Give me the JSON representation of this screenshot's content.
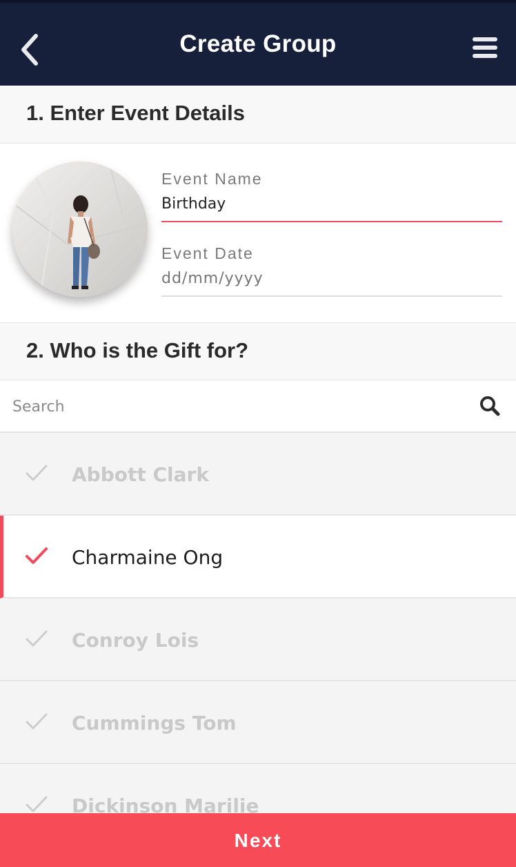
{
  "header": {
    "title": "Create Group",
    "back_icon": "chevron-left-icon",
    "menu_icon": "hamburger-menu-icon"
  },
  "section1": {
    "heading": "1. Enter Event Details",
    "avatar_icon": "event-photo",
    "event_name": {
      "label": "Event Name",
      "value": "Birthday"
    },
    "event_date": {
      "label": "Event Date",
      "placeholder": "dd/mm/yyyy"
    }
  },
  "section2": {
    "heading": "2. Who is the Gift for?",
    "search": {
      "placeholder": "Search",
      "icon": "search-icon"
    },
    "people": [
      {
        "name": "Abbott Clark",
        "selected": false
      },
      {
        "name": "Charmaine Ong",
        "selected": true
      },
      {
        "name": "Conroy Lois",
        "selected": false
      },
      {
        "name": "Cummings Tom",
        "selected": false
      },
      {
        "name": "Dickinson Marilie",
        "selected": false
      }
    ]
  },
  "footer": {
    "next_label": "Next"
  },
  "colors": {
    "header_bg": "#17203a",
    "accent": "#f74b57",
    "underline_active": "#f14a5c",
    "check_inactive": "#cccccc"
  }
}
